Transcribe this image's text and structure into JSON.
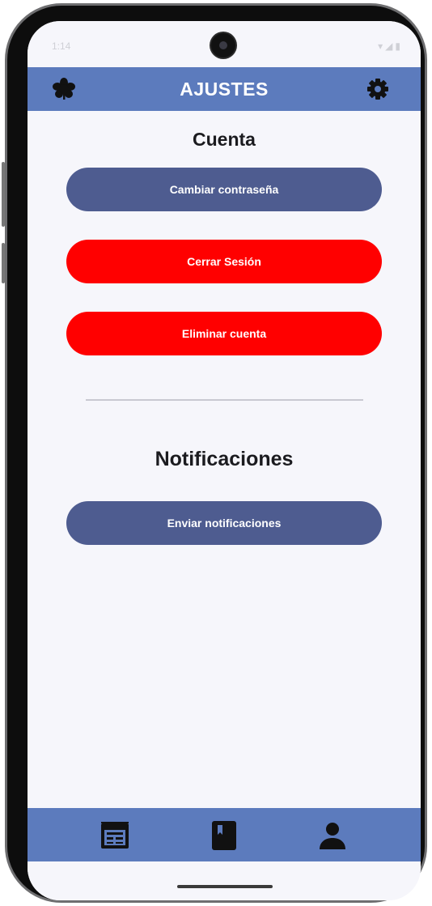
{
  "status": {
    "time": "1:14",
    "icons": "▾◢▮"
  },
  "app_bar": {
    "title": "AJUSTES",
    "left_icon": "lotus-logo-icon",
    "right_icon": "gear-icon"
  },
  "account": {
    "title": "Cuenta",
    "change_password": "Cambiar contraseña",
    "logout": "Cerrar Sesión",
    "delete_account": "Eliminar cuenta"
  },
  "notifications": {
    "title": "Notificaciones",
    "send": "Enviar notificaciones"
  },
  "bottom_nav": {
    "items": [
      "calendar-grid-icon",
      "book-icon",
      "person-icon"
    ]
  },
  "colors": {
    "app_bar": "#5c7bbd",
    "primary_button": "#4e5c90",
    "danger_button": "#ff0000",
    "background": "#f6f6fb"
  }
}
